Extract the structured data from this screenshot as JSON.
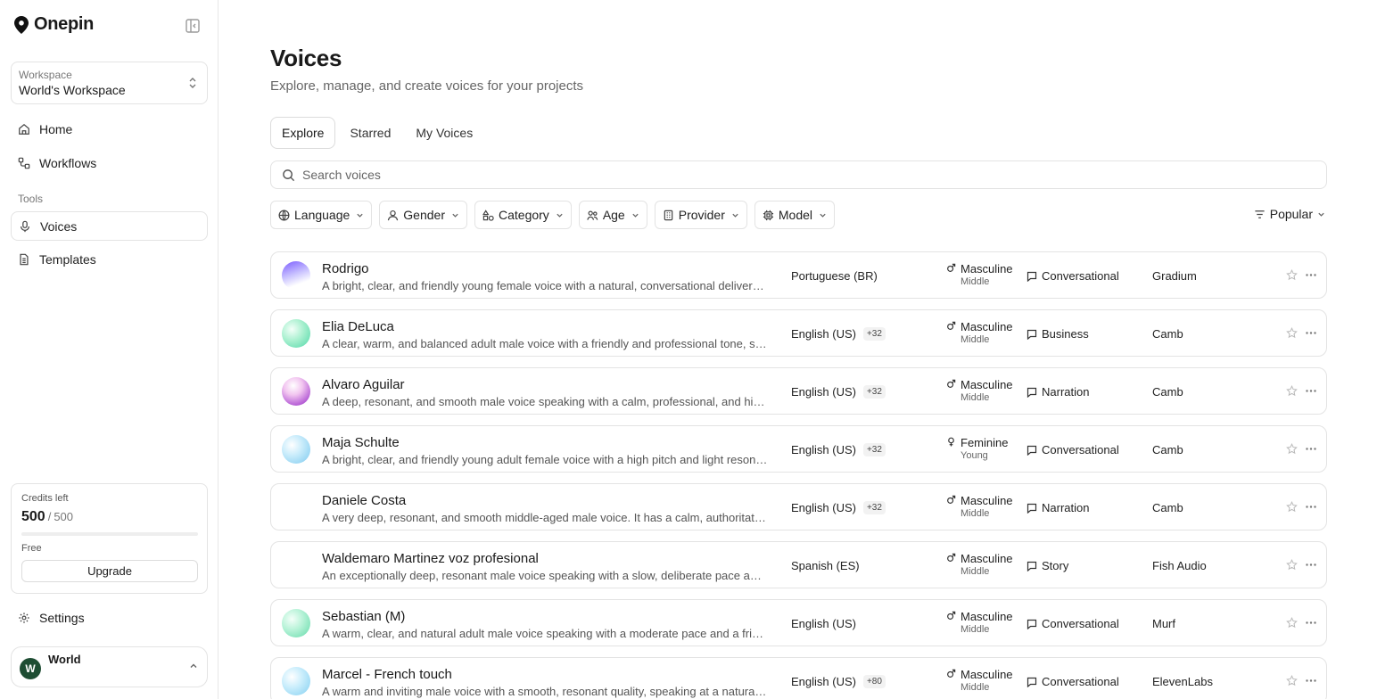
{
  "brand": {
    "name": "Onepin"
  },
  "workspace": {
    "label": "Workspace",
    "name": "World's Workspace"
  },
  "nav": {
    "home": "Home",
    "workflows": "Workflows",
    "tools_label": "Tools",
    "voices": "Voices",
    "templates": "Templates"
  },
  "credits": {
    "label": "Credits left",
    "used": "500",
    "separator": "/",
    "total": "500",
    "remaining_fraction": 0,
    "plan": "Free",
    "upgrade_label": "Upgrade"
  },
  "settings_label": "Settings",
  "user": {
    "name": "World",
    "initial": "W"
  },
  "page": {
    "title": "Voices",
    "subtitle": "Explore, manage, and create voices for your projects"
  },
  "tabs": [
    {
      "label": "Explore",
      "active": true
    },
    {
      "label": "Starred",
      "active": false
    },
    {
      "label": "My Voices",
      "active": false
    }
  ],
  "search": {
    "placeholder": "Search voices",
    "value": ""
  },
  "filters": [
    {
      "label": "Language",
      "icon": "globe-icon"
    },
    {
      "label": "Gender",
      "icon": "user-icon"
    },
    {
      "label": "Category",
      "icon": "shapes-icon"
    },
    {
      "label": "Age",
      "icon": "people-icon"
    },
    {
      "label": "Provider",
      "icon": "building-icon"
    },
    {
      "label": "Model",
      "icon": "cpu-icon"
    }
  ],
  "sort": {
    "label": "Popular",
    "icon": "sort-lines-icon"
  },
  "voices": [
    {
      "name": "Rodrigo",
      "description": "A bright, clear, and friendly young female voice with a natural, conversational delivery and light tone.",
      "language": "Portuguese (BR)",
      "extra_languages": "",
      "gender": "Masculine",
      "gender_icon": "male-icon",
      "age": "Middle",
      "category": "Conversational",
      "provider": "Gradium",
      "orb": "linear-gradient(160deg, #7b5cff 0%, #c9c2ff 45%, #ffffff 75%)"
    },
    {
      "name": "Elia DeLuca",
      "description": "A clear, warm, and balanced adult male voice with a friendly and professional tone, speaking steadily.",
      "language": "English (US)",
      "extra_languages": "+32",
      "gender": "Masculine",
      "gender_icon": "male-icon",
      "age": "Middle",
      "category": "Business",
      "provider": "Camb",
      "orb": "radial-gradient(circle at 35% 35%, #f4fff9 0%, #a8f0cf 45%, #4fd6a8 100%)"
    },
    {
      "name": "Alvaro Aguilar",
      "description": "A deep, resonant, and smooth male voice speaking with a calm, professional, and highly articulate tone.",
      "language": "English (US)",
      "extra_languages": "+32",
      "gender": "Masculine",
      "gender_icon": "male-icon",
      "age": "Middle",
      "category": "Narration",
      "provider": "Camb",
      "orb": "radial-gradient(circle at 40% 30%, #ffffff 0%, #f2c6f0 35%, #b65fd6 75%, #8d3bb8 100%)"
    },
    {
      "name": "Maja Schulte",
      "description": "A bright, clear, and friendly young adult female voice with a high pitch and light resonance, speaking warmly.",
      "language": "English (US)",
      "extra_languages": "+32",
      "gender": "Feminine",
      "gender_icon": "female-icon",
      "age": "Young",
      "category": "Conversational",
      "provider": "Camb",
      "orb": "radial-gradient(circle at 35% 35%, #ffffff 0%, #c9ecfb 40%, #7cc9ef 100%)"
    },
    {
      "name": "Daniele Costa",
      "description": "A very deep, resonant, and smooth middle-aged male voice. It has a calm, authoritative and steady delivery.",
      "language": "English (US)",
      "extra_languages": "+32",
      "gender": "Masculine",
      "gender_icon": "male-icon",
      "age": "Middle",
      "category": "Narration",
      "provider": "Camb",
      "orb": "#ffffff"
    },
    {
      "name": "Waldemaro Martinez voz profesional",
      "description": "An exceptionally deep, resonant male voice speaking with a slow, deliberate pace and a commanding tone.",
      "language": "Spanish (ES)",
      "extra_languages": "",
      "gender": "Masculine",
      "gender_icon": "male-icon",
      "age": "Middle",
      "category": "Story",
      "provider": "Fish Audio",
      "orb": "#ffffff"
    },
    {
      "name": "Sebastian (M)",
      "description": "A warm, clear, and natural adult male voice speaking with a moderate pace and a friendly, approachable tone.",
      "language": "English (US)",
      "extra_languages": "",
      "gender": "Masculine",
      "gender_icon": "male-icon",
      "age": "Middle",
      "category": "Conversational",
      "provider": "Murf",
      "orb": "radial-gradient(circle at 35% 35%, #f4fff9 0%, #b4f2d6 45%, #62d9a9 100%)"
    },
    {
      "name": "Marcel - French touch",
      "description": "A warm and inviting male voice with a smooth, resonant quality, speaking at a natural, relaxed pace.",
      "language": "English (US)",
      "extra_languages": "+80",
      "gender": "Masculine",
      "gender_icon": "male-icon",
      "age": "Middle",
      "category": "Conversational",
      "provider": "ElevenLabs",
      "orb": "radial-gradient(circle at 35% 35%, #ffffff 0%, #cbeefc 40%, #83cff1 100%)"
    }
  ]
}
